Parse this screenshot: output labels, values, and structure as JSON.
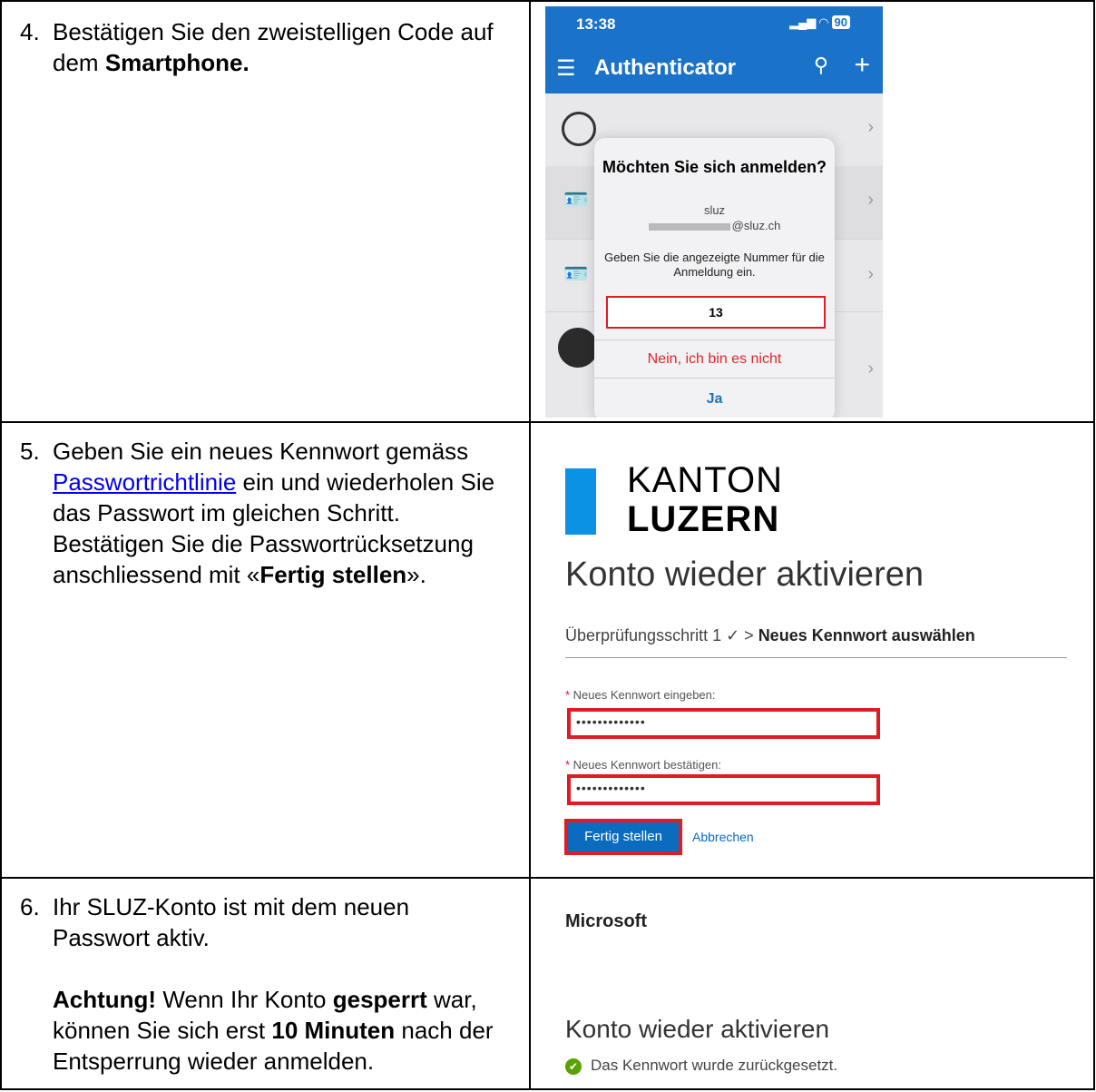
{
  "rows": [
    {
      "number": "4.",
      "text_before": "Bestätigen Sie den zweistelligen Code auf dem ",
      "text_bold": "Smartphone."
    },
    {
      "number": "5.",
      "text_before": "Geben Sie ein neues Kennwort gemäss ",
      "link": "Passwortrichtlinie",
      "text_middle": " ein und wiederholen Sie das Passwort im gleichen Schritt. Bestätigen Sie die Passwortrücksetzung anschliessend mit «",
      "text_bold": "Fertig stellen",
      "text_after": "»."
    },
    {
      "number": "6.",
      "text_line1": "Ihr SLUZ-Konto ist mit dem neuen Passwort aktiv.",
      "warning_bold1": "Achtung!",
      "warning_text1": " Wenn Ihr Konto ",
      "warning_bold2": "gesperrt",
      "warning_text2": " war, können Sie sich erst ",
      "warning_bold3": "10 Minuten",
      "warning_text3": " nach der Entsperrung wieder anmelden."
    }
  ],
  "phone": {
    "time": "13:38",
    "battery": "90",
    "app_title": "Authenticator",
    "dialog_title": "Möchten Sie sich anmelden?",
    "dialog_org": "sluz",
    "dialog_email": "@sluz.ch",
    "dialog_message": "Geben Sie die angezeigte Nummer für die Anmeldung ein.",
    "dialog_number": "13",
    "deny_label": "Nein, ich bin es nicht",
    "approve_label": "Ja"
  },
  "kanton": {
    "logo_line1": "KANTON",
    "logo_line2": "LUZERN",
    "heading": "Konto wieder aktivieren",
    "breadcrumb_step": "Überprüfungsschritt 1 ✓ > ",
    "breadcrumb_current": "Neues Kennwort auswählen",
    "field1_label": "Neues Kennwort eingeben:",
    "field1_value": "•••••••••••••",
    "field2_label": "Neues Kennwort bestätigen:",
    "field2_value": "•••••••••••••",
    "submit_label": "Fertig stellen",
    "cancel_label": "Abbrechen"
  },
  "microsoft": {
    "brand": "Microsoft",
    "heading": "Konto wieder aktivieren",
    "status": "Das Kennwort wurde zurückgesetzt."
  },
  "colors": {
    "highlight": "#e01b22",
    "authenticator_blue": "#1a73c9",
    "kanton_blue": "#0b92e5",
    "success_green": "#57a300"
  }
}
